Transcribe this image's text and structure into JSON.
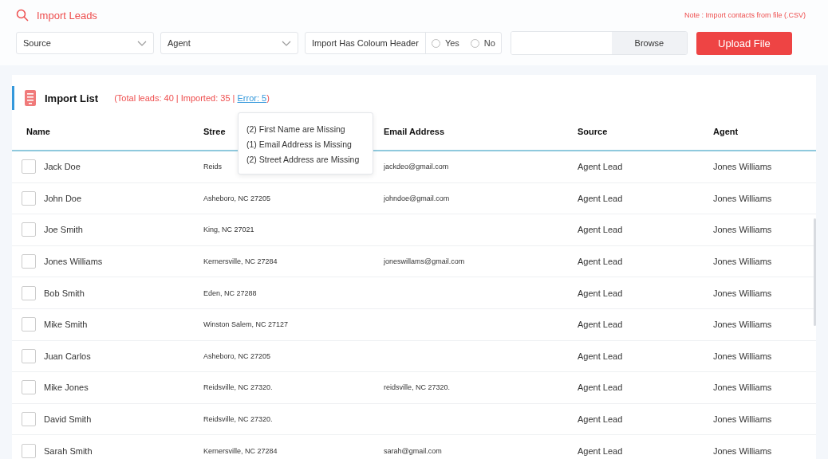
{
  "header": {
    "title": "Import Leads",
    "note": "Note : Import contacts from file (.CSV)"
  },
  "filters": {
    "source": {
      "value": "Source"
    },
    "agent": {
      "value": "Agent"
    },
    "header_option": {
      "label": "Import Has Coloum Header",
      "options": [
        {
          "label": "Yes",
          "selected": false
        },
        {
          "label": "No",
          "selected": false
        }
      ]
    },
    "file": {
      "browse": "Browse",
      "upload": "Upload File"
    }
  },
  "import_list": {
    "title": "Import List",
    "summary_prefix": "(Total leads: 40 | Imported: 35 | ",
    "error_link": "Error: 5",
    "summary_suffix": ")",
    "error_popover": [
      "(2) First Name are Missing",
      "(1) Email Address is Missing",
      "(2) Street Address are Missing"
    ],
    "columns": [
      "Name",
      "Stree",
      "Email Address",
      "Source",
      "Agent"
    ],
    "rows": [
      {
        "checked": false,
        "name": "Jack Doe",
        "street": "Reids",
        "email": "jackdeo@gmail.com",
        "source": "Agent Lead",
        "agent": "Jones Williams"
      },
      {
        "checked": false,
        "name": "John Doe",
        "street": "Asheboro, NC 27205",
        "email": "johndoe@gmail.com",
        "source": "Agent Lead",
        "agent": "Jones Williams"
      },
      {
        "checked": false,
        "name": "Joe Smith",
        "street": "King, NC 27021",
        "email": "",
        "source": "Agent Lead",
        "agent": "Jones Williams"
      },
      {
        "checked": false,
        "name": "Jones Williams",
        "street": "Kernersville, NC 27284",
        "email": "joneswillams@gmail.com",
        "source": "Agent Lead",
        "agent": "Jones Williams"
      },
      {
        "checked": false,
        "name": "Bob Smith",
        "street": "Eden, NC 27288",
        "email": "",
        "source": "Agent Lead",
        "agent": "Jones Williams"
      },
      {
        "checked": false,
        "name": "Mike Smith",
        "street": "Winston Salem, NC 27127",
        "email": "",
        "source": "Agent Lead",
        "agent": "Jones Williams"
      },
      {
        "checked": false,
        "name": "Juan Carlos",
        "street": "Asheboro, NC 27205",
        "email": "",
        "source": "Agent Lead",
        "agent": "Jones Williams"
      },
      {
        "checked": false,
        "name": "Mike Jones",
        "street": "Reidsville, NC 27320.",
        "email": "reidsville, NC 27320.",
        "source": "Agent Lead",
        "agent": "Jones Williams"
      },
      {
        "checked": false,
        "name": "David Smith",
        "street": "Reidsville, NC 27320.",
        "email": "",
        "source": "Agent Lead",
        "agent": "Jones Williams"
      },
      {
        "checked": false,
        "name": "Sarah Smith",
        "street": "Kernersville, NC 27284",
        "email": "sarah@gmail.com",
        "source": "Agent Lead",
        "agent": "Jones Williams"
      }
    ]
  }
}
